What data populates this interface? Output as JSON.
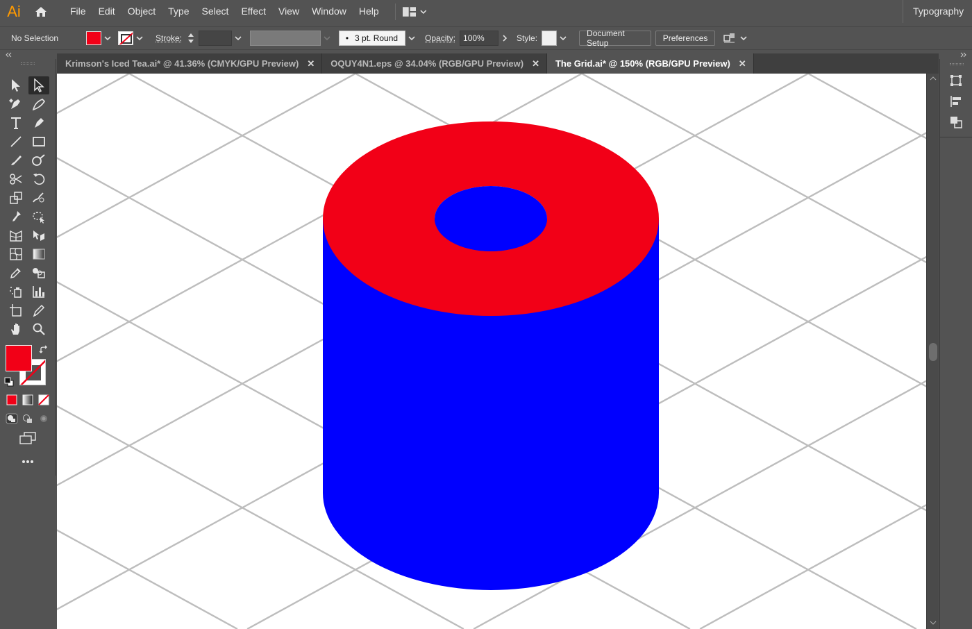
{
  "app": {
    "logo": "Ai"
  },
  "menu": [
    "File",
    "Edit",
    "Object",
    "Type",
    "Select",
    "Effect",
    "View",
    "Window",
    "Help"
  ],
  "workspace": "Typography",
  "control": {
    "selection": "No Selection",
    "stroke_label": "Stroke:",
    "brush": "3 pt. Round",
    "opacity_label": "Opacity:",
    "opacity_value": "100%",
    "style_label": "Style:",
    "document_setup": "Document Setup",
    "preferences": "Preferences"
  },
  "tabs": [
    {
      "label": "Krimson's Iced Tea.ai* @ 41.36% (CMYK/GPU Preview)",
      "active": false
    },
    {
      "label": "OQUY4N1.eps @ 34.04% (RGB/GPU Preview)",
      "active": false
    },
    {
      "label": "The Grid.ai* @ 150% (RGB/GPU Preview)",
      "active": true
    }
  ],
  "colors": {
    "fill": "#f20017",
    "cylinder_body": "#0000ff",
    "cylinder_top": "#f20017",
    "grid_line": "#bdbdbd",
    "canvas_bg": "#ffffff",
    "ui_bg": "#535353"
  },
  "icons": {
    "home": "home-icon",
    "selection": "selection-tool-icon",
    "direct_selection": "direct-selection-tool-icon",
    "curvature": "curvature-tool-icon",
    "pen": "pen-tool-icon",
    "type": "type-tool-icon",
    "line": "line-segment-tool-icon",
    "rectangle": "rectangle-tool-icon",
    "paintbrush": "paintbrush-tool-icon",
    "shaper": "shaper-tool-icon",
    "scissors": "scissors-tool-icon",
    "rotate": "rotate-tool-icon",
    "scale": "scale-tool-icon",
    "warp": "warp-tool-icon",
    "puppet_warp": "puppet-warp-tool-icon",
    "free_transform": "free-transform-tool-icon",
    "perspective": "perspective-grid-tool-icon",
    "shape_builder": "shape-builder-tool-icon",
    "mesh": "mesh-tool-icon",
    "gradient": "gradient-tool-icon",
    "eyedropper": "eyedropper-tool-icon",
    "blend": "blend-tool-icon",
    "symbol_sprayer": "symbol-sprayer-tool-icon",
    "graph": "column-graph-tool-icon",
    "artboard": "artboard-tool-icon",
    "slice": "slice-tool-icon",
    "hand": "hand-tool-icon",
    "zoom": "zoom-tool-icon",
    "swap": "swap-fill-stroke-icon",
    "default_colors": "default-fill-stroke-icon",
    "color": "color-mode-icon",
    "gradient_mode": "gradient-mode-icon",
    "none": "none-mode-icon",
    "draw_normal": "draw-normal-icon",
    "draw_behind": "draw-behind-icon",
    "draw_inside": "draw-inside-icon",
    "screen_mode": "screen-mode-icon",
    "more_tools": "edit-toolbar-icon",
    "transform_panel": "transform-panel-icon",
    "align_panel": "align-panel-icon",
    "pathfinder_panel": "pathfinder-panel-icon"
  }
}
